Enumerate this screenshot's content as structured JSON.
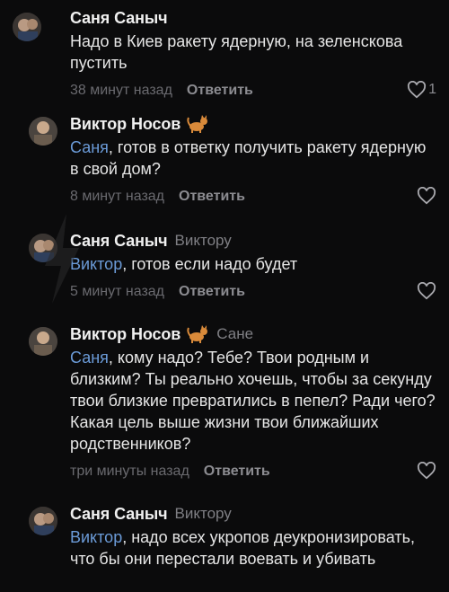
{
  "comments": [
    {
      "author": "Саня Саныч",
      "reply_to": "",
      "mention": "",
      "text": "Надо в Киев ракету ядерную, на зеленскова пустить",
      "time": "38 минут назад",
      "reply_label": "Ответить",
      "likes": "1",
      "has_emoji": false
    },
    {
      "author": "Виктор Носов",
      "reply_to": "",
      "mention": "Саня",
      "text": ", готов в ответку получить ракету ядерную в свой дом?",
      "time": "8 минут назад",
      "reply_label": "Ответить",
      "likes": "",
      "has_emoji": true
    },
    {
      "author": "Саня Саныч",
      "reply_to": "Виктору",
      "mention": "Виктор",
      "text": ", готов если надо будет",
      "time": "5 минут назад",
      "reply_label": "Ответить",
      "likes": "",
      "has_emoji": false
    },
    {
      "author": "Виктор Носов",
      "reply_to": "Сане",
      "mention": "Саня",
      "text": ", кому надо? Тебе? Твои родным и близким? Ты реально хочешь, чтобы за секунду твои близкие превратились в пепел? Ради чего? Какая цель выше жизни твои ближайших родственников?",
      "time": "три минуты назад",
      "reply_label": "Ответить",
      "likes": "",
      "has_emoji": true
    },
    {
      "author": "Саня Саныч",
      "reply_to": "Виктору",
      "mention": "Виктор",
      "text": ", надо всех укропов деукронизировать, что бы они перестали воевать и убивать",
      "time": "",
      "reply_label": "",
      "likes": "",
      "has_emoji": false
    }
  ],
  "icons": {
    "like": "heart-outline-icon",
    "badge": "cat-emoji-icon"
  },
  "colors": {
    "background": "#0b0b0c",
    "mention": "#6b9bd8",
    "muted": "#6a6a6f"
  }
}
